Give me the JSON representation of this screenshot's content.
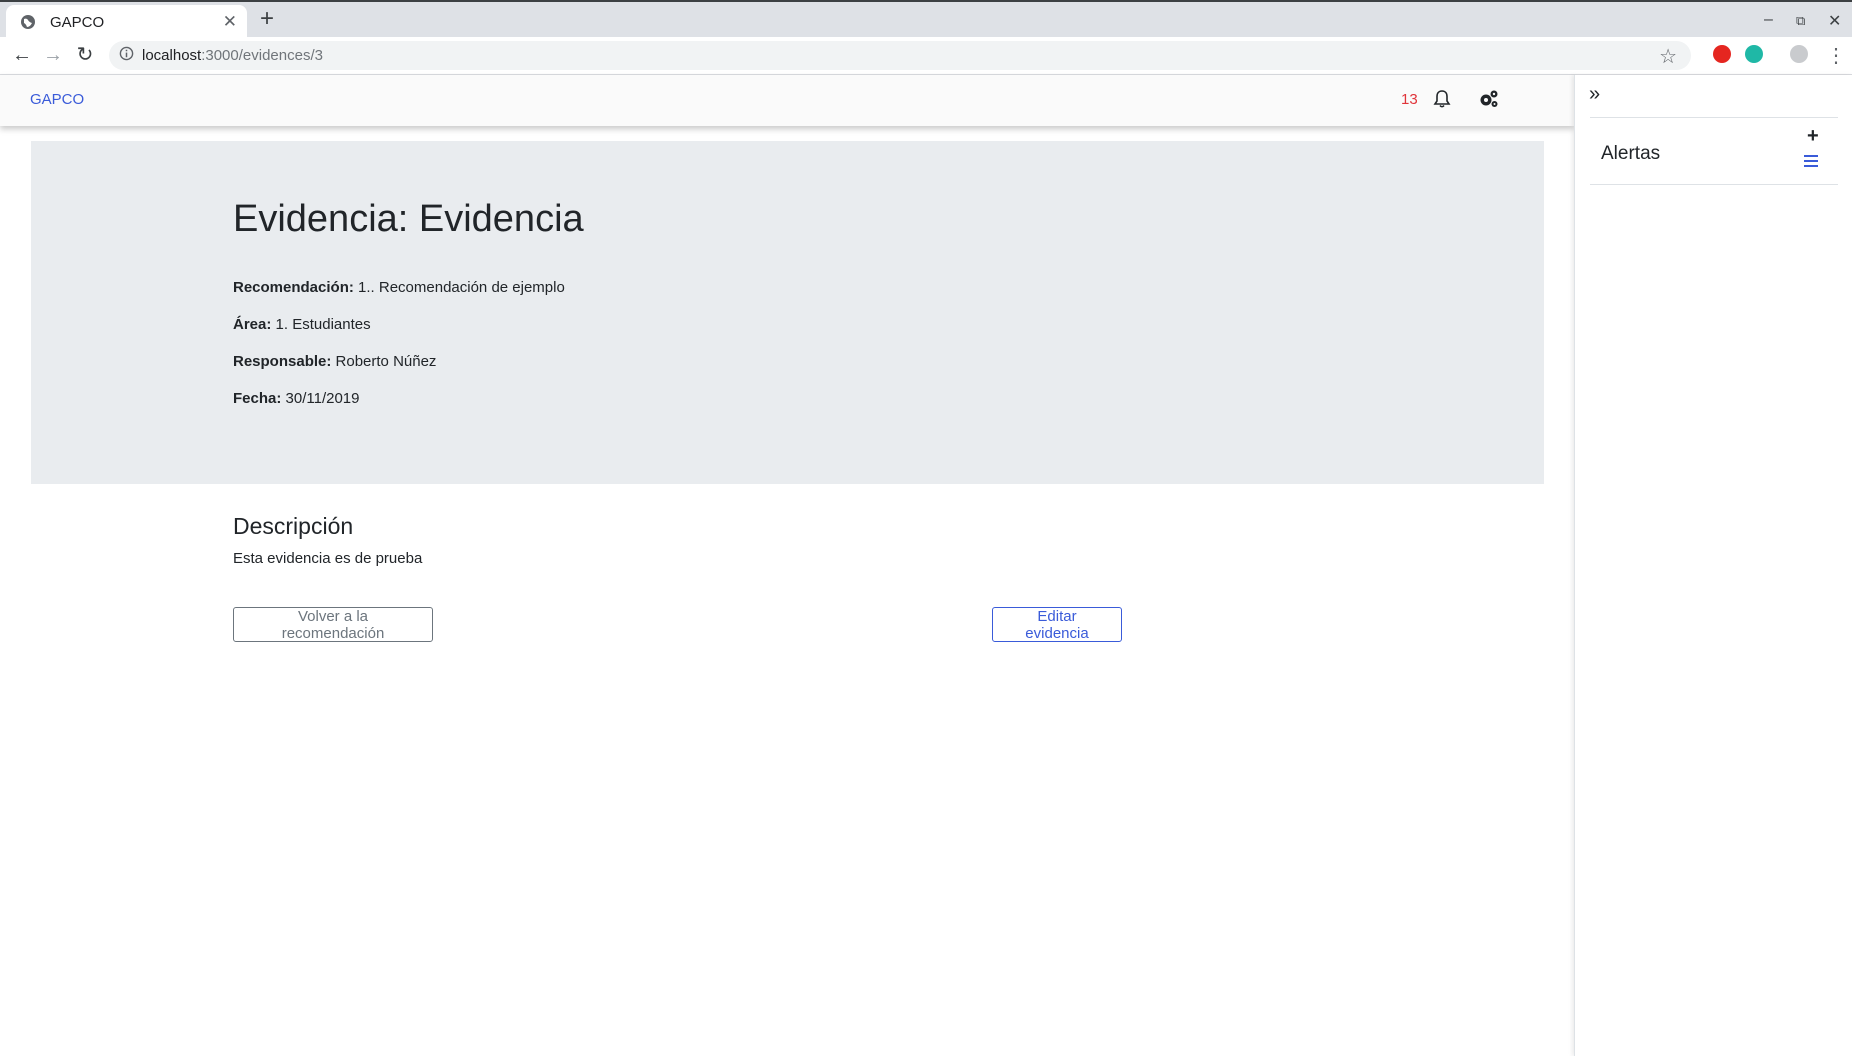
{
  "browser": {
    "tab_title": "GAPCO",
    "url_host": "localhost",
    "url_path": ":3000/evidences/3"
  },
  "navbar": {
    "brand": "GAPCO",
    "notification_count": "13"
  },
  "evidence": {
    "title": "Evidencia: Evidencia",
    "fields": [
      {
        "label": "Recomendación:",
        "value": "1.. Recomendación de ejemplo"
      },
      {
        "label": "Área:",
        "value": "1. Estudiantes"
      },
      {
        "label": "Responsable:",
        "value": "Roberto Núñez"
      },
      {
        "label": "Fecha:",
        "value": "30/11/2019"
      }
    ],
    "description_heading": "Descripción",
    "description_text": "Esta evidencia es de prueba"
  },
  "actions": {
    "back_label": "Volver a la recomendación",
    "edit_label": "Editar evidencia"
  },
  "sidebar": {
    "title": "Alertas"
  },
  "colors": {
    "accent": "#3a5bd9",
    "notification": "#e0343a",
    "jumbotron": "#e9ecef"
  },
  "icons": [
    "globe-icon",
    "close-icon",
    "plus-icon",
    "back-arrow-icon",
    "forward-arrow-icon",
    "reload-icon",
    "info-icon",
    "star-icon",
    "bell-icon",
    "cogs-icon",
    "double-chevron-right-icon",
    "list-icon"
  ]
}
